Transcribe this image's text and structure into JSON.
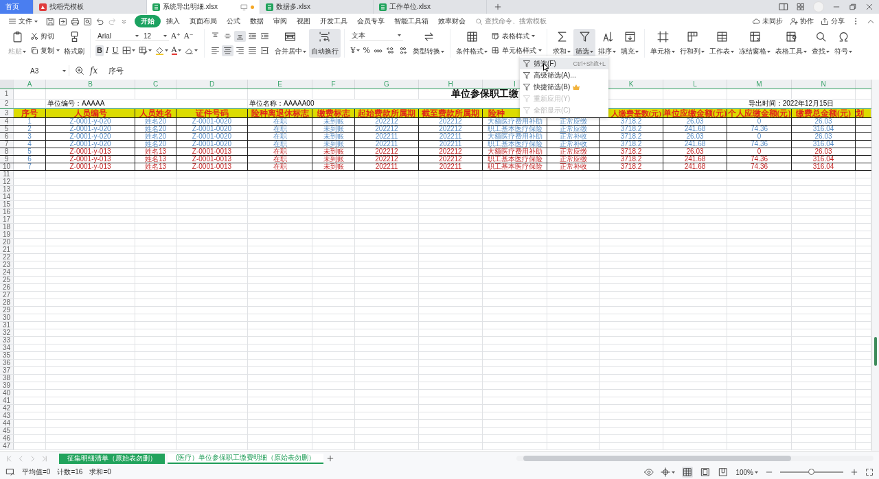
{
  "window_tabs": [
    {
      "label": "首页",
      "kind": "home",
      "selected": false,
      "unsaved": false
    },
    {
      "label": "找稻壳模板",
      "kind": "docer",
      "selected": false,
      "unsaved": false
    },
    {
      "label": "系统导出明细.xlsx",
      "kind": "sheet",
      "selected": true,
      "unsaved": true
    },
    {
      "label": "数据多.xlsx",
      "kind": "sheet",
      "selected": false,
      "unsaved": false
    },
    {
      "label": "工作单位.xlsx",
      "kind": "sheet",
      "selected": false,
      "unsaved": false
    }
  ],
  "menu": {
    "file": "文件",
    "tabs": [
      {
        "label": "开始",
        "selected": true
      },
      {
        "label": "插入",
        "selected": false
      },
      {
        "label": "页面布局",
        "selected": false
      },
      {
        "label": "公式",
        "selected": false
      },
      {
        "label": "数据",
        "selected": false
      },
      {
        "label": "审阅",
        "selected": false
      },
      {
        "label": "视图",
        "selected": false
      },
      {
        "label": "开发工具",
        "selected": false
      },
      {
        "label": "会员专享",
        "selected": false
      },
      {
        "label": "智能工具箱",
        "selected": false
      },
      {
        "label": "效率财会",
        "selected": false
      }
    ],
    "search": {
      "placeholder": "查找命令、搜索模板"
    },
    "actions": [
      "未同步",
      "协作",
      "分享"
    ]
  },
  "ribbon": [
    {
      "items": [
        {
          "kind": "large",
          "label": "粘贴",
          "dropdown": true,
          "pressed": false,
          "disabled": true
        },
        {
          "kind": "stack",
          "items": [
            {
              "label": "剪切",
              "dropdown": false
            },
            {
              "label": "复制",
              "dropdown": true
            }
          ]
        },
        {
          "kind": "large",
          "label": "格式刷",
          "dropdown": false,
          "pressed": false,
          "disabled": false
        }
      ]
    },
    {
      "items": [
        {
          "kind": "lines",
          "lines": [
            [
              {
                "kind": "select",
                "value": "Arial"
              },
              {
                "kind": "select",
                "value": "12"
              },
              {
                "kind": "glyph",
                "text": "A⁺",
                "pressed": false,
                "dropdown": false
              },
              {
                "kind": "glyph",
                "text": "A⁻",
                "pressed": false,
                "dropdown": false
              }
            ],
            [
              {
                "kind": "glyph",
                "text": "B",
                "pressed": true,
                "dropdown": false
              },
              {
                "kind": "glyph",
                "text": "I",
                "pressed": false,
                "dropdown": false
              },
              {
                "kind": "glyph",
                "text": "U",
                "pressed": false,
                "dropdown": false
              },
              {
                "kind": "tool",
                "pressed": false,
                "dropdown": true
              },
              {
                "kind": "tool",
                "pressed": false,
                "dropdown": true
              },
              {
                "kind": "tool",
                "pressed": false,
                "dropdown": true
              },
              {
                "kind": "glyph",
                "text": "A",
                "pressed": false,
                "dropdown": true
              },
              {
                "kind": "tool",
                "pressed": false,
                "dropdown": true
              }
            ]
          ]
        }
      ]
    },
    {
      "items": [
        {
          "kind": "lines",
          "lines": [
            [
              {
                "kind": "tool",
                "pressed": false,
                "dropdown": false
              },
              {
                "kind": "tool",
                "pressed": false,
                "dropdown": false
              },
              {
                "kind": "tool",
                "pressed": true,
                "dropdown": false
              },
              {
                "kind": "tool",
                "pressed": false,
                "dropdown": false
              },
              {
                "kind": "tool",
                "pressed": false,
                "dropdown": false
              }
            ],
            [
              {
                "kind": "tool",
                "pressed": false,
                "dropdown": false
              },
              {
                "kind": "tool",
                "pressed": true,
                "dropdown": false
              },
              {
                "kind": "tool",
                "pressed": false,
                "dropdown": false
              },
              {
                "kind": "tool",
                "pressed": false,
                "dropdown": false
              },
              {
                "kind": "tool",
                "pressed": false,
                "dropdown": false
              }
            ]
          ]
        },
        {
          "kind": "large",
          "label": "合并居中",
          "dropdown": true,
          "pressed": false,
          "disabled": false
        },
        {
          "kind": "large",
          "label": "自动换行",
          "dropdown": false,
          "pressed": true,
          "disabled": false
        }
      ]
    },
    {
      "items": [
        {
          "kind": "lines",
          "lines": [
            [
              {
                "kind": "select",
                "value": "文本"
              }
            ],
            [
              {
                "kind": "glyph",
                "text": "¥",
                "pressed": false,
                "dropdown": true
              },
              {
                "kind": "glyph",
                "text": "%",
                "pressed": false,
                "dropdown": false
              },
              {
                "kind": "tool",
                "pressed": false,
                "dropdown": false
              },
              {
                "kind": "tool",
                "pressed": false,
                "dropdown": false
              },
              {
                "kind": "tool",
                "pressed": false,
                "dropdown": false
              }
            ]
          ]
        },
        {
          "kind": "large",
          "label": "类型转换",
          "dropdown": true,
          "pressed": false,
          "disabled": false
        }
      ]
    },
    {
      "items": [
        {
          "kind": "large",
          "label": "条件格式",
          "dropdown": true,
          "pressed": false,
          "disabled": false
        },
        {
          "kind": "stack",
          "items": [
            {
              "label": "表格样式",
              "dropdown": true
            },
            {
              "label": "单元格样式",
              "dropdown": true
            }
          ]
        }
      ]
    },
    {
      "items": [
        {
          "kind": "large",
          "label": "求和",
          "dropdown": true,
          "pressed": false,
          "disabled": false
        },
        {
          "kind": "large",
          "label": "筛选",
          "dropdown": true,
          "pressed": true,
          "disabled": false
        },
        {
          "kind": "large",
          "label": "排序",
          "dropdown": true,
          "pressed": false,
          "disabled": false
        },
        {
          "kind": "large",
          "label": "填充",
          "dropdown": true,
          "pressed": false,
          "disabled": false
        }
      ]
    },
    {
      "items": [
        {
          "kind": "large",
          "label": "单元格",
          "dropdown": true,
          "pressed": false,
          "disabled": false
        },
        {
          "kind": "large",
          "label": "行和列",
          "dropdown": true,
          "pressed": false,
          "disabled": false
        },
        {
          "kind": "large",
          "label": "工作表",
          "dropdown": true,
          "pressed": false,
          "disabled": false
        },
        {
          "kind": "large",
          "label": "冻结窗格",
          "dropdown": true,
          "pressed": false,
          "disabled": false
        },
        {
          "kind": "large",
          "label": "表格工具",
          "dropdown": true,
          "pressed": false,
          "disabled": false
        },
        {
          "kind": "large",
          "label": "查找",
          "dropdown": true,
          "pressed": false,
          "disabled": false
        },
        {
          "kind": "large",
          "label": "符号",
          "dropdown": true,
          "pressed": false,
          "disabled": false
        }
      ]
    }
  ],
  "formula_bar": {
    "cell_ref": "A3",
    "fx": "fx",
    "value": "序号"
  },
  "filter_menu": [
    {
      "label": "筛选(F)",
      "shortcut": "Ctrl+Shift+L",
      "selected": true,
      "disabled": false,
      "premium": false
    },
    {
      "label": "高级筛选(A)...",
      "selected": false,
      "disabled": false,
      "premium": false
    },
    {
      "label": "快捷筛选(B)",
      "selected": false,
      "disabled": false,
      "premium": true
    },
    {
      "label": "重新应用(Y)",
      "selected": false,
      "disabled": true,
      "premium": false
    },
    {
      "label": "全部显示(C)",
      "selected": false,
      "disabled": true,
      "premium": false
    }
  ],
  "sheet": {
    "columns": [
      {
        "kind": "letter",
        "text": "A"
      },
      {
        "kind": "letter",
        "text": "B"
      },
      {
        "kind": "letter",
        "text": "C"
      },
      {
        "kind": "letter",
        "text": "D"
      },
      {
        "kind": "letter",
        "text": "E"
      },
      {
        "kind": "letter",
        "text": "F"
      },
      {
        "kind": "letter",
        "text": "G"
      },
      {
        "kind": "letter",
        "text": "H"
      },
      {
        "kind": "letter",
        "text": "I"
      },
      {
        "kind": "covered"
      },
      {
        "kind": "letter",
        "text": "K"
      },
      {
        "kind": "letter",
        "text": "L"
      },
      {
        "kind": "letter",
        "text": "M"
      },
      {
        "kind": "letter",
        "text": "N"
      }
    ],
    "row_numbers": [
      "1",
      "2",
      "3",
      "4",
      "5",
      "6",
      "7",
      "8",
      "9",
      "10",
      "11",
      "12",
      "13",
      "14",
      "15",
      "16",
      "17",
      "18",
      "19",
      "20",
      "21",
      "22",
      "23",
      "24",
      "25",
      "26",
      "27",
      "28",
      "29",
      "30",
      "31",
      "32",
      "33",
      "34",
      "35",
      "36",
      "37",
      "38",
      "39",
      "40",
      "41",
      "42",
      "43",
      "44",
      "45",
      "46",
      "47"
    ],
    "title": "单位参保职工缴",
    "unit_code": "单位编号：AAAAA",
    "unit_name": "单位名称：AAAAA00",
    "export_time": "导出时间：2022年12月15日",
    "headers": [
      {
        "kind": "title",
        "text": "序号"
      },
      {
        "kind": "title",
        "text": "人员编号"
      },
      {
        "kind": "title",
        "text": "人员姓名"
      },
      {
        "kind": "title",
        "text": "证件号码"
      },
      {
        "kind": "title",
        "text": "险种离退休标志"
      },
      {
        "kind": "title",
        "text": "缴费标志"
      },
      {
        "kind": "title",
        "text": "起始费款所属期"
      },
      {
        "kind": "title",
        "text": "截至费款所属期"
      },
      {
        "kind": "title",
        "text": "险种"
      },
      {
        "kind": "covered"
      },
      {
        "kind": "title",
        "text": "人缴费基数(元)"
      },
      {
        "kind": "title",
        "text": "单位应缴金额(元)"
      },
      {
        "kind": "title",
        "text": "个人应缴金额(元)"
      },
      {
        "kind": "title",
        "text": "缴费总金额(元)"
      },
      {
        "kind": "title",
        "text": "划"
      }
    ],
    "rows": [
      {
        "flagged": false,
        "cells": [
          "1",
          "Z-0001-y-020",
          "姓名20",
          "Z-0001-0020",
          "在职",
          "未到账",
          "202212",
          "202212",
          "大额医疗费用补助",
          "正常应缴",
          "3718.2",
          "26.03",
          "0",
          "26.03"
        ]
      },
      {
        "flagged": false,
        "cells": [
          "2",
          "Z-0001-y-020",
          "姓名20",
          "Z-0001-0020",
          "在职",
          "未到账",
          "202212",
          "202212",
          "职工基本医疗保险",
          "正常应缴",
          "3718.2",
          "241.68",
          "74.36",
          "316.04"
        ]
      },
      {
        "flagged": false,
        "cells": [
          "3",
          "Z-0001-y-020",
          "姓名20",
          "Z-0001-0020",
          "在职",
          "未到账",
          "202211",
          "202211",
          "大额医疗费用补助",
          "正常补收",
          "3718.2",
          "26.03",
          "0",
          "26.03"
        ]
      },
      {
        "flagged": false,
        "cells": [
          "4",
          "Z-0001-y-020",
          "姓名20",
          "Z-0001-0020",
          "在职",
          "未到账",
          "202211",
          "202211",
          "职工基本医疗保险",
          "正常补收",
          "3718.2",
          "241.68",
          "74.36",
          "316.04"
        ]
      },
      {
        "flagged": true,
        "cells": [
          "5",
          "Z-0001-y-013",
          "姓名13",
          "Z-0001-0013",
          "在职",
          "未到账",
          "202212",
          "202212",
          "大额医疗费用补助",
          "正常应缴",
          "3718.2",
          "26.03",
          "0",
          "26.03"
        ]
      },
      {
        "flagged": true,
        "cells": [
          "6",
          "Z-0001-y-013",
          "姓名13",
          "Z-0001-0013",
          "在职",
          "未到账",
          "202212",
          "202212",
          "职工基本医疗保险",
          "正常应缴",
          "3718.2",
          "241.68",
          "74.36",
          "316.04"
        ]
      },
      {
        "flagged": true,
        "cells": [
          "7",
          "Z-0001-y-013",
          "姓名13",
          "Z-0001-0013",
          "在职",
          "未到账",
          "202211",
          "202211",
          "职工基本医疗保险",
          "正常补收",
          "3718.2",
          "241.68",
          "74.36",
          "316.04"
        ]
      }
    ]
  },
  "sheet_tabs": [
    {
      "label": "征集明细清单（原始表勿删）",
      "selected": false,
      "color": "#21a35c"
    },
    {
      "label": "(医疗）单位参保职工缴费明细（原始表勿删）",
      "selected": true
    }
  ],
  "status_bar": {
    "stats": [
      "平均值=0",
      "计数=16",
      "求和=0"
    ],
    "views": [
      {
        "kind": "normal",
        "selected": true
      },
      {
        "kind": "page_break",
        "selected": false
      },
      {
        "kind": "page_layout",
        "selected": false
      }
    ],
    "zoom": "100%",
    "zoom_slider": {
      "level": 0.5
    }
  }
}
